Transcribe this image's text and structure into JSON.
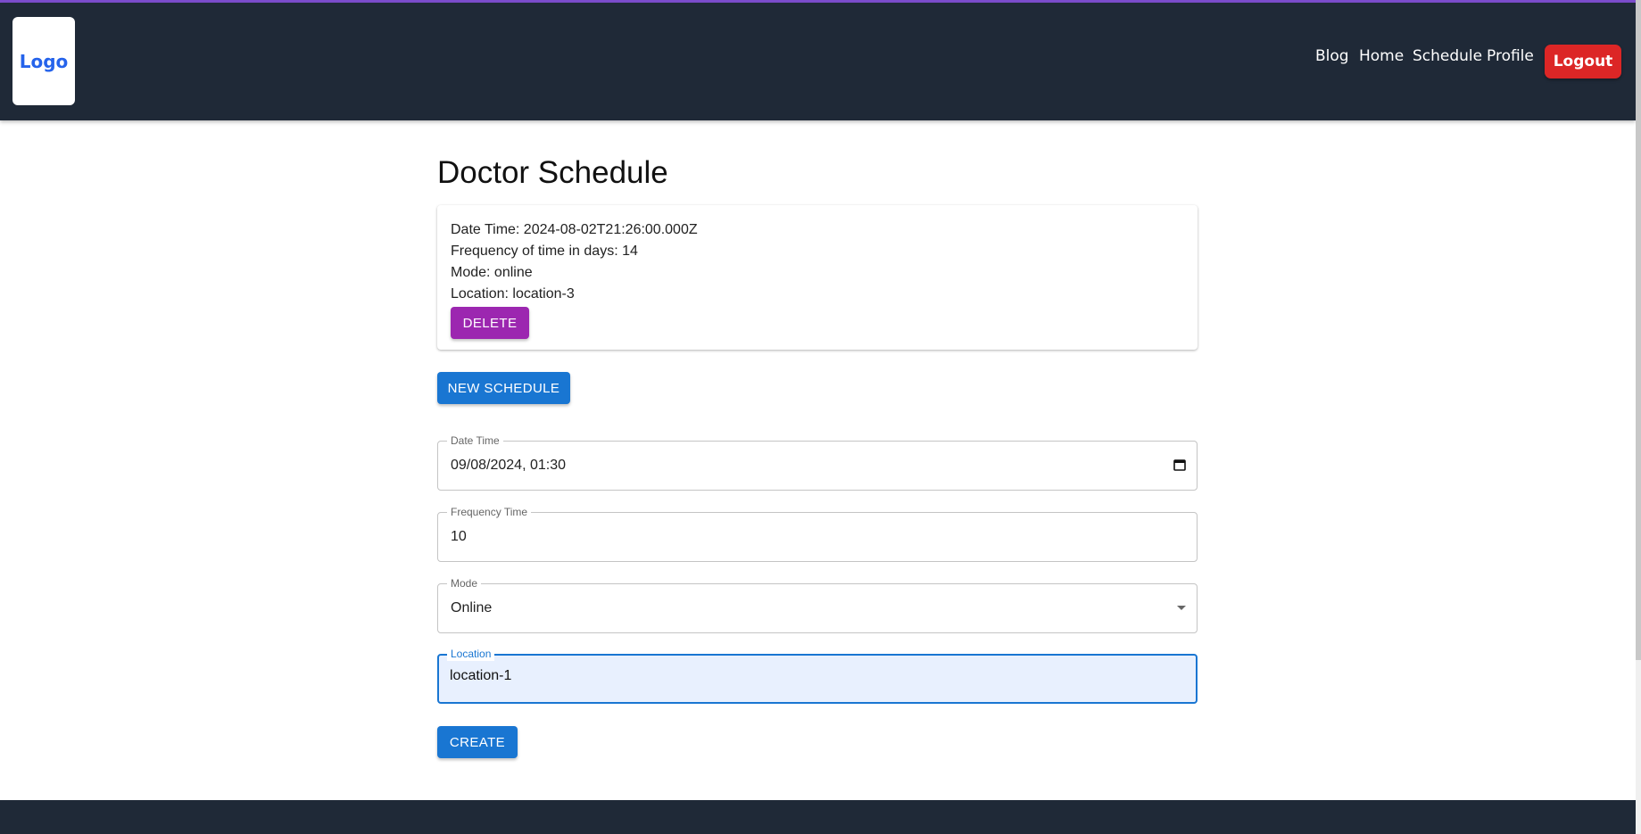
{
  "header": {
    "logo_text": "Logo",
    "nav": {
      "blog": "Blog",
      "home": "Home",
      "schedule": "Schedule",
      "profile": "Profile"
    },
    "logout_label": "Logout",
    "colors": {
      "navbar": "#1f2937",
      "logout": "#dc2626",
      "logo_text": "#2563eb"
    }
  },
  "main": {
    "title": "Doctor Schedule",
    "schedule_card": {
      "date_time": "Date Time: 2024-08-02T21:26:00.000Z",
      "frequency": "Frequency of time in days: 14",
      "mode": "Mode: online",
      "location": "Location: location-3",
      "delete_label": "DELETE"
    },
    "new_schedule_label": "NEW SCHEDULE",
    "form": {
      "date_time": {
        "label": "Date Time",
        "value": "09/08/2024, 01:30"
      },
      "frequency_time": {
        "label": "Frequency Time",
        "value": "10"
      },
      "mode": {
        "label": "Mode",
        "value": "Online"
      },
      "location": {
        "label": "Location",
        "value": "location-1"
      },
      "create_label": "CREATE"
    },
    "colors": {
      "primary": "#1976d2",
      "delete": "#9c27b0"
    }
  }
}
